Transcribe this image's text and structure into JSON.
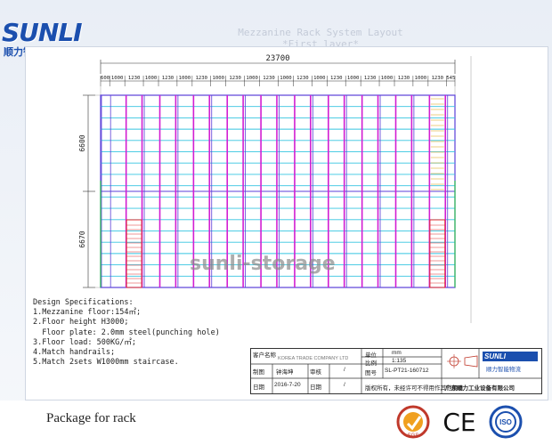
{
  "brand": {
    "logo_text": "SUNLI",
    "logo_subtitle": "顺力智能物流"
  },
  "title": {
    "line1": "Mezzanine Rack System Layout",
    "line2": "*First layer*"
  },
  "drawing": {
    "total_width_label": "23700",
    "bay_labels": [
      "600",
      "1000",
      "1230",
      "1000",
      "1230",
      "1000",
      "1230",
      "1000",
      "1230",
      "1000",
      "1230",
      "1000",
      "1230",
      "1000",
      "1230",
      "1000",
      "1230",
      "1000",
      "1230",
      "1000",
      "1230",
      "545"
    ],
    "height_labels": [
      "6600",
      "6670"
    ],
    "watermark": "sunli-storage"
  },
  "specs": {
    "heading": "Design Specifications:",
    "items": [
      "1.Mezzanine floor:154㎡;",
      "2.Floor height H3000;",
      "  Floor plate: 2.0mm steel(punching hole)",
      "3.Floor load: 500KG/㎡;",
      "4.Match handrails;",
      "5.Match 2sets W1000mm staircase."
    ]
  },
  "title_block": {
    "client_label": "客户名称",
    "client_value": "KOREA TRADE COMPANY LTD",
    "unit_label": "单位",
    "unit_value": "mm",
    "scale_label": "比例",
    "scale_value": "1:135",
    "drawing_no_label": "图号",
    "drawing_no_value": "SL-PT21-160712",
    "company_logo": "SUNLI",
    "company_logo_sub": "顺力智能物流",
    "company_name": "广东顺力工业设备有限公司",
    "row2_label": "制图",
    "row2_value": "钟海坤",
    "row2_label2": "审核",
    "row3_label": "日期",
    "row3_value": "2016-7-20",
    "row3_label2": "日期",
    "note": "版权所有，未经许可不得用作其他用途",
    "slash": "/"
  },
  "footer": {
    "text": "Package for rack",
    "certs": [
      "SGS",
      "CE",
      "ISO"
    ]
  },
  "colors": {
    "upright": "#d21ed2",
    "beam": "#35c4e0",
    "frame": "#5b3fd8",
    "stair": "#e03030",
    "handrail": "#e0b030",
    "brand": "#1b4fae"
  }
}
